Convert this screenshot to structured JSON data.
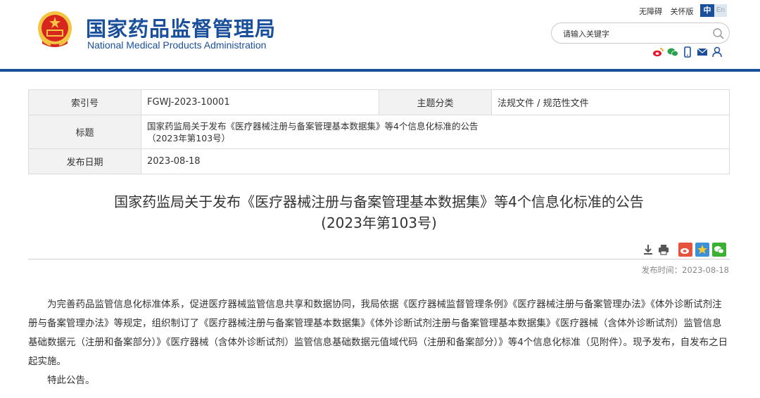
{
  "header": {
    "site_name_cn": "国家药品监督管理局",
    "site_name_en": "National Medical Products Administration",
    "top_links": [
      "无障碍",
      "关怀版"
    ],
    "lang_cn": "中",
    "lang_en": "En",
    "search_placeholder": "请输入关键字",
    "social_icons": [
      "weibo-icon",
      "wechat-icon",
      "mobile-icon",
      "mail-icon",
      "user-icon"
    ]
  },
  "info": {
    "index_label": "索引号",
    "index_value": "FGWJ-2023-10001",
    "category_label": "主题分类",
    "category_value": "法规文件 / 规范性文件",
    "title_label": "标题",
    "title_value_line1": "国家药监局关于发布《医疗器械注册与备案管理基本数据集》等4个信息化标准的公告",
    "title_value_line2": "（2023年第103号）",
    "date_label": "发布日期",
    "date_value": "2023-08-18"
  },
  "article": {
    "title_line1": "国家药监局关于发布《医疗器械注册与备案管理基本数据集》等4个信息化标准的公告",
    "title_line2": "(2023年第103号)",
    "publish_time": "发布时间：2023-08-18",
    "paragraphs": [
      "为完善药品监管信息化标准体系，促进医疗器械监管信息共享和数据协同，我局依据《医疗器械监督管理条例》《医疗器械注册与备案管理办法》《体外诊断试剂注册与备案管理办法》等规定，组织制订了《医疗器械注册与备案管理基本数据集》《体外诊断试剂注册与备案管理基本数据集》《医疗器械（含体外诊断试剂）监管信息基础数据元（注册和备案部分）》《医疗器械（含体外诊断试剂）监管信息基础数据元值域代码（注册和备案部分）》等4个信息化标准（见附件）。现予发布，自发布之日起实施。",
      "特此公告。"
    ]
  },
  "colors": {
    "brand_blue": "#1a4f9c",
    "emblem_red": "#d7261e",
    "emblem_gold": "#f4c542"
  }
}
